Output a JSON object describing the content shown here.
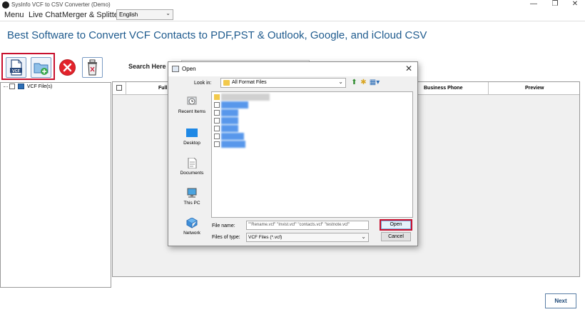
{
  "app": {
    "title": "SysInfo VCF to CSV Converter (Demo)",
    "window_controls": {
      "minimize": "—",
      "maximize": "❐",
      "close": "✕"
    }
  },
  "menu": {
    "items": [
      "Menu",
      "Live Chat",
      "Merger & Splitter"
    ],
    "language": "English"
  },
  "heading": "Best Software to Convert VCF Contacts to PDF,PST & Outlook, Google, and iCloud CSV",
  "toolbar": {
    "add_vcf_icon_text": "VCF"
  },
  "search": {
    "label": "Search Here :-",
    "value": ""
  },
  "tree": {
    "root_label": "VCF File(s)"
  },
  "table": {
    "columns": [
      "Full",
      "Business Phone",
      "Preview"
    ]
  },
  "footer": {
    "next_label": "Next"
  },
  "dialog": {
    "title": "Open",
    "close": "✕",
    "look_in_label": "Look in:",
    "look_in_value": "All Format Files",
    "places": [
      "Recent Items",
      "Desktop",
      "Documents",
      "This PC",
      "Network"
    ],
    "file_name_label": "File name:",
    "file_name_value": "\"\"Rename.vcf\" \"Invist.vcf\" \"contacts.vcf\" \"testnote.vcf\"",
    "files_of_type_label": "Files of type:",
    "files_of_type_value": "VCF Files (*.vcf)",
    "open_label": "Open",
    "cancel_label": "Cancel"
  },
  "colors": {
    "heading": "#1f5b8e",
    "highlight": "#c8102e",
    "selection": "#3b86e8",
    "remove_button": "#e3232b"
  }
}
